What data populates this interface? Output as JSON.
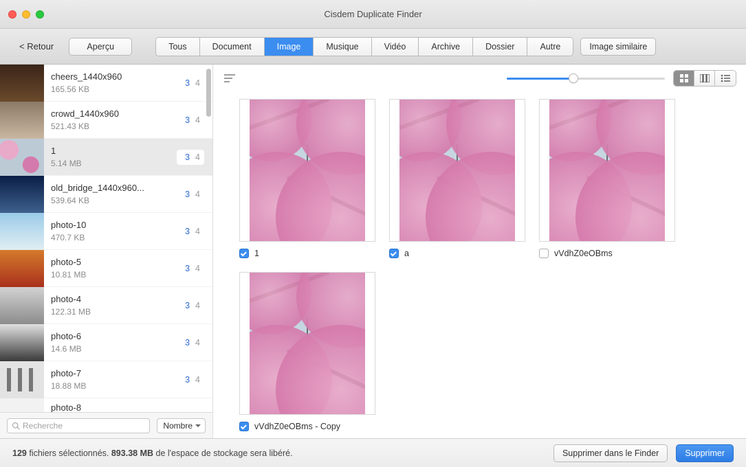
{
  "window": {
    "title": "Cisdem Duplicate Finder"
  },
  "toolbar": {
    "back": "< Retour",
    "preview": "Aperçu",
    "tabs": [
      "Tous",
      "Document",
      "Image",
      "Musique",
      "Vidéo",
      "Archive",
      "Dossier",
      "Autre"
    ],
    "active_tab": "Image",
    "similar": "Image similaire"
  },
  "sidebar": {
    "items": [
      {
        "name": "cheers_1440x960",
        "size": "165.56 KB",
        "sel": "3",
        "tot": "4"
      },
      {
        "name": "crowd_1440x960",
        "size": "521.43 KB",
        "sel": "3",
        "tot": "4"
      },
      {
        "name": "1",
        "size": "5.14 MB",
        "sel": "3",
        "tot": "4",
        "selected": true
      },
      {
        "name": "old_bridge_1440x960...",
        "size": "539.64 KB",
        "sel": "3",
        "tot": "4"
      },
      {
        "name": "photo-10",
        "size": "470.7 KB",
        "sel": "3",
        "tot": "4"
      },
      {
        "name": "photo-5",
        "size": "10.81 MB",
        "sel": "3",
        "tot": "4"
      },
      {
        "name": "photo-4",
        "size": "122.31 MB",
        "sel": "3",
        "tot": "4"
      },
      {
        "name": "photo-6",
        "size": "14.6 MB",
        "sel": "3",
        "tot": "4"
      },
      {
        "name": "photo-7",
        "size": "18.88 MB",
        "sel": "3",
        "tot": "4"
      },
      {
        "name": "photo-8",
        "size": "",
        "sel": "",
        "tot": ""
      }
    ],
    "search_placeholder": "Recherche",
    "sort_label": "Nombre"
  },
  "content": {
    "files": [
      {
        "name": "1",
        "checked": true
      },
      {
        "name": "a",
        "checked": true
      },
      {
        "name": "vVdhZ0eOBms",
        "checked": false
      },
      {
        "name": "vVdhZ0eOBms - Copy",
        "checked": true
      }
    ],
    "slider_percent": 42
  },
  "footer": {
    "count": "129",
    "count_suffix": "fichiers sélectionnés.",
    "size": "893.38 MB",
    "size_suffix": "de l'espace de stockage sera libéré.",
    "btn_finder": "Supprimer dans le Finder",
    "btn_delete": "Supprimer"
  }
}
